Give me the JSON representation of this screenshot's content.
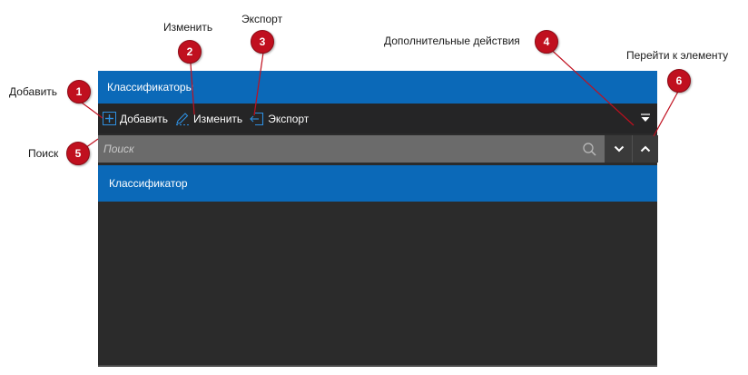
{
  "panel": {
    "title": "Классификаторы",
    "toolbar": {
      "add_label": "Добавить",
      "edit_label": "Изменить",
      "export_label": "Экспорт"
    },
    "search": {
      "placeholder": "Поиск"
    },
    "list": [
      {
        "label": "Классификатор"
      }
    ]
  },
  "callouts": [
    {
      "number": "1",
      "label": "Добавить"
    },
    {
      "number": "2",
      "label": "Изменить"
    },
    {
      "number": "3",
      "label": "Экспорт"
    },
    {
      "number": "4",
      "label": "Дополнительные действия"
    },
    {
      "number": "5",
      "label": "Поиск"
    },
    {
      "number": "6",
      "label": "Перейти к элементу"
    }
  ],
  "colors": {
    "accent": "#0b69b8",
    "badge": "#c0101f",
    "toolbar_bg": "#252526",
    "panel_bg": "#2b2b2b"
  },
  "icons": {
    "add": "plus-square-icon",
    "edit": "pencil-icon",
    "export": "export-icon",
    "more": "triangle-down-icon",
    "search": "search-icon",
    "next": "chevron-down-icon",
    "prev": "chevron-up-icon"
  }
}
